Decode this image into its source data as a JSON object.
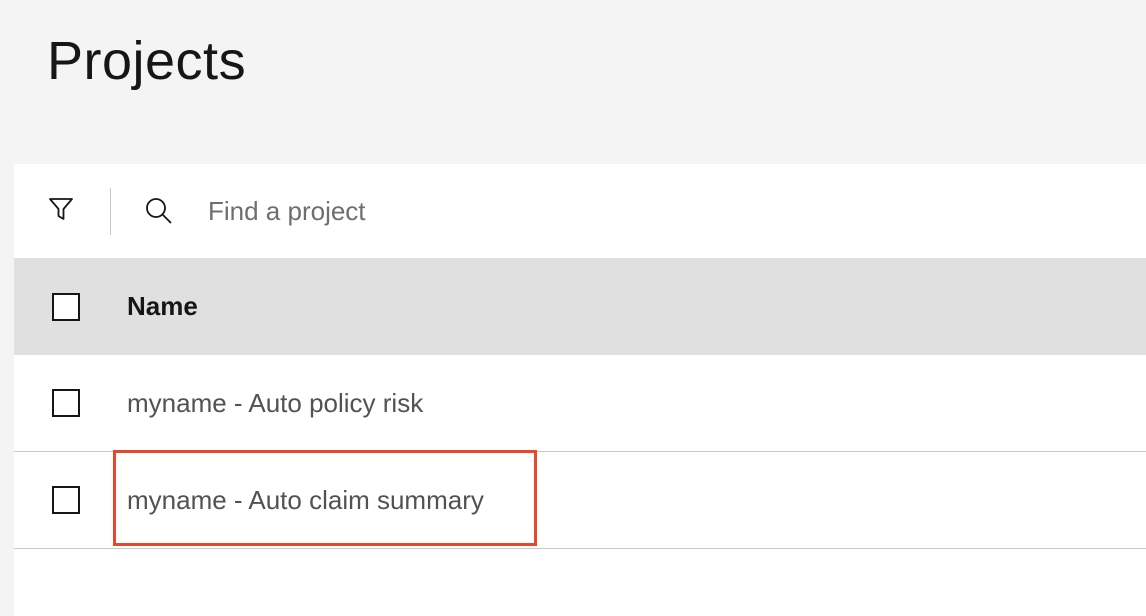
{
  "page": {
    "title": "Projects"
  },
  "toolbar": {
    "filter_icon": "filter-icon",
    "search_icon": "search-icon",
    "search_placeholder": "Find a project",
    "search_value": ""
  },
  "table": {
    "columns": [
      "Name"
    ],
    "rows": [
      {
        "name": "myname - Auto policy risk",
        "selected": false
      },
      {
        "name": "myname - Auto claim summary",
        "selected": false,
        "highlighted": true
      }
    ]
  },
  "colors": {
    "page_background": "#f4f4f4",
    "header_background": "#e0e0e0",
    "highlight_border": "#e8472b"
  }
}
